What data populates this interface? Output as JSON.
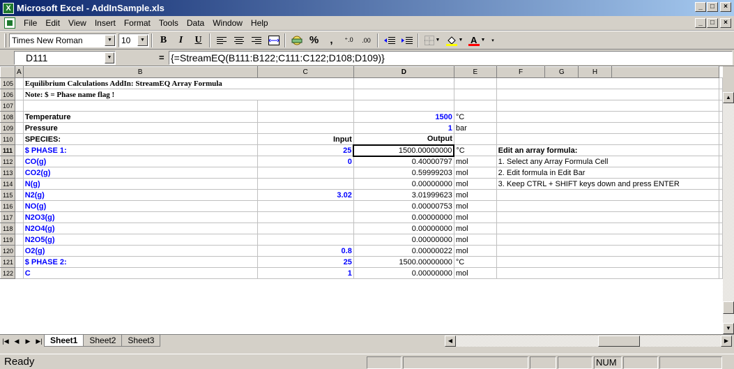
{
  "window": {
    "title": "Microsoft Excel - AddInSample.xls",
    "app_icon_glyph": "X",
    "minimize_glyph": "_",
    "maximize_glyph": "□",
    "close_glyph": "×"
  },
  "menu": {
    "items": [
      "File",
      "Edit",
      "View",
      "Insert",
      "Format",
      "Tools",
      "Data",
      "Window",
      "Help"
    ]
  },
  "toolbar": {
    "font_name": "Times New Roman",
    "font_size": "10",
    "bold_label": "B",
    "italic_label": "I",
    "underline_label": "U",
    "percent_label": "%",
    "comma_label": ",",
    "inc_decimal_label": "⁺.0",
    "dec_decimal_label": ".00"
  },
  "formula_bar": {
    "name_box": "D111",
    "equals": "=",
    "formula": "{=StreamEQ(B111:B122;C111:C122;D108;D109)}"
  },
  "sheet": {
    "columns": [
      "A",
      "B",
      "C",
      "D",
      "E",
      "F",
      "G",
      "H"
    ],
    "active_column": "D",
    "active_row": "111",
    "rows": [
      {
        "n": "105",
        "b": "Equilibrium Calculations AddIn: StreamEQ Array Formula",
        "c": "",
        "d": "",
        "e": "",
        "f": ""
      },
      {
        "n": "106",
        "b": "Note: $ = Phase name flag !",
        "c": "",
        "d": "",
        "e": "",
        "f": ""
      },
      {
        "n": "107",
        "b": "",
        "c": "",
        "d": "",
        "e": "",
        "f": ""
      },
      {
        "n": "108",
        "b": "Temperature",
        "c": "",
        "d": "1500",
        "e": "°C",
        "f": ""
      },
      {
        "n": "109",
        "b": "Pressure",
        "c": "",
        "d": "1",
        "e": "bar",
        "f": ""
      },
      {
        "n": "110",
        "b": "SPECIES:",
        "c": "Input",
        "d": "Output",
        "e": "",
        "f": ""
      },
      {
        "n": "111",
        "b": "$ PHASE 1:",
        "c": "25",
        "d": "1500.00000000",
        "e": "°C",
        "f": "Edit an array formula:"
      },
      {
        "n": "112",
        "b": "CO(g)",
        "c": "0",
        "d": "0.40000797",
        "e": "mol",
        "f": "1. Select any Array Formula Cell"
      },
      {
        "n": "113",
        "b": "CO2(g)",
        "c": "",
        "d": "0.59999203",
        "e": "mol",
        "f": "2. Edit formula in Edit Bar"
      },
      {
        "n": "114",
        "b": "N(g)",
        "c": "",
        "d": "0.00000000",
        "e": "mol",
        "f": "3. Keep CTRL + SHIFT keys down and press ENTER"
      },
      {
        "n": "115",
        "b": "N2(g)",
        "c": "3.02",
        "d": "3.01999623",
        "e": "mol",
        "f": ""
      },
      {
        "n": "116",
        "b": "NO(g)",
        "c": "",
        "d": "0.00000753",
        "e": "mol",
        "f": ""
      },
      {
        "n": "117",
        "b": "N2O3(g)",
        "c": "",
        "d": "0.00000000",
        "e": "mol",
        "f": ""
      },
      {
        "n": "118",
        "b": "N2O4(g)",
        "c": "",
        "d": "0.00000000",
        "e": "mol",
        "f": ""
      },
      {
        "n": "119",
        "b": "N2O5(g)",
        "c": "",
        "d": "0.00000000",
        "e": "mol",
        "f": ""
      },
      {
        "n": "120",
        "b": "O2(g)",
        "c": "0.8",
        "d": "0.00000022",
        "e": "mol",
        "f": ""
      },
      {
        "n": "121",
        "b": "$ PHASE 2:",
        "c": "25",
        "d": "1500.00000000",
        "e": "°C",
        "f": ""
      },
      {
        "n": "122",
        "b": "C",
        "c": "1",
        "d": "0.00000000",
        "e": "mol",
        "f": ""
      }
    ]
  },
  "tabs": {
    "nav_first": "|◀",
    "nav_prev": "◀",
    "nav_next": "▶",
    "nav_last": "▶|",
    "items": [
      "Sheet1",
      "Sheet2",
      "Sheet3"
    ],
    "active": "Sheet1"
  },
  "status": {
    "text": "Ready",
    "num_indicator": "NUM"
  }
}
